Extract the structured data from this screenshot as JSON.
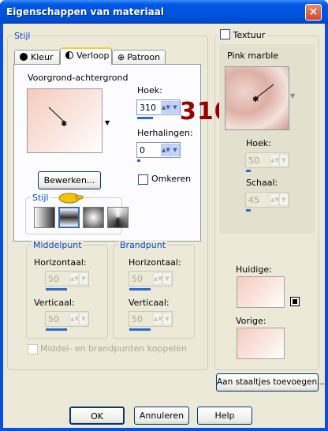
{
  "title": "Eigenschappen van materiaal",
  "close_label": "×",
  "stijl_group": "Stijl",
  "tabs": [
    "Kleur",
    "Verloop",
    "Patroon"
  ],
  "gradient_name": "Voorgrond-achtergrond",
  "hoek_label": "Hoek:",
  "hoek_value": "310",
  "herhalingen_label": "Herhalingen:",
  "herhalingen_value": "0",
  "bewerken_label": "Bewerken...",
  "omkeren_label": "Omkeren",
  "stijl_sub_label": "Stijl",
  "middelpunt_group": "Middelpunt",
  "brandpunt_group": "Brandpunt",
  "horizontaal_label": "Horizontaal:",
  "verticaal_label": "Verticaal:",
  "mp_h_value": "50",
  "mp_v_value": "50",
  "bp_h_value": "50",
  "bp_v_value": "50",
  "koppelen_label": "Middel- en brandpunten koppelen",
  "annotation": "310",
  "textuur_label": "Textuur",
  "texture_name": "Pink marble",
  "tex_hoek_label": "Hoek:",
  "tex_hoek_value": "50",
  "schaal_label": "Schaal:",
  "schaal_value": "45",
  "huidige_label": "Huidige:",
  "vorige_label": "Vorige:",
  "add_swatch_label": "Aan staaltjes toevoegen...",
  "ok_label": "OK",
  "cancel_label": "Annuleren",
  "help_label": "Help",
  "colors": {
    "titlebar": "#0054e3",
    "group_label": "#0046d5",
    "annotation": "#9b0000",
    "swatch_pink": "#f6cbbd"
  }
}
